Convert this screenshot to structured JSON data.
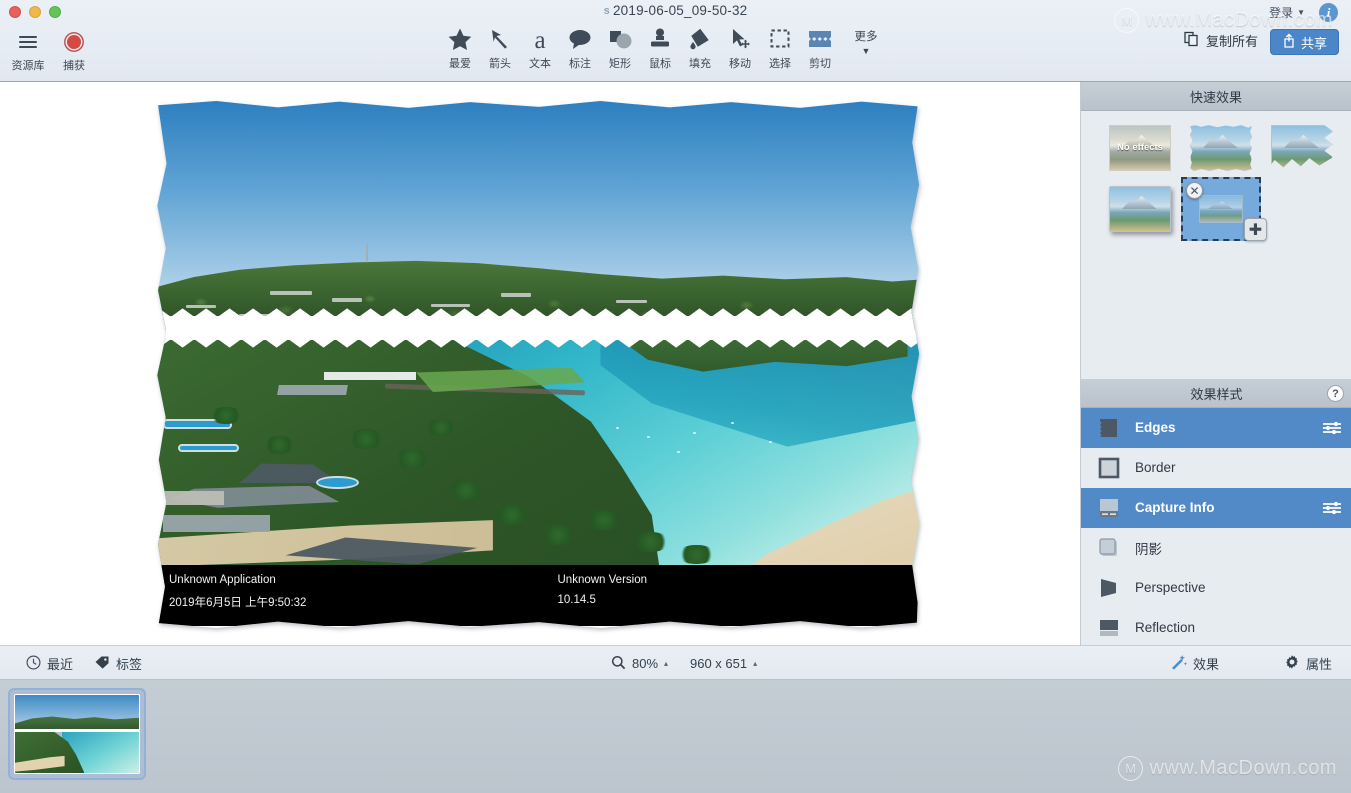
{
  "window": {
    "title": "2019-06-05_09-50-32",
    "title_icon": "s",
    "traffic_lights": [
      "close",
      "minimize",
      "zoom"
    ]
  },
  "left_tools": [
    {
      "label": "资源库",
      "icon": "library-icon"
    },
    {
      "label": "捕获",
      "icon": "capture-record-icon"
    }
  ],
  "center_tools": [
    {
      "label": "最爱",
      "icon": "star-icon"
    },
    {
      "label": "箭头",
      "icon": "arrow-icon"
    },
    {
      "label": "文本",
      "icon": "text-icon"
    },
    {
      "label": "标注",
      "icon": "callout-icon"
    },
    {
      "label": "矩形",
      "icon": "shapes-icon"
    },
    {
      "label": "鼠标",
      "icon": "stamp-icon"
    },
    {
      "label": "填充",
      "icon": "fill-icon"
    },
    {
      "label": "移动",
      "icon": "move-icon"
    },
    {
      "label": "选择",
      "icon": "selection-icon"
    },
    {
      "label": "剪切",
      "icon": "cut-icon"
    }
  ],
  "more_tool": {
    "label": "更多",
    "caret": "▼"
  },
  "account": {
    "signin_label": "登录",
    "caret": "▼",
    "info_label": "i"
  },
  "actions": {
    "copy_all_label": "复制所有",
    "share_label": "共享"
  },
  "quick_effects": {
    "title": "快速效果",
    "items": [
      {
        "name": "no-effects",
        "label": "No effects"
      },
      {
        "name": "torn-edges",
        "label": ""
      },
      {
        "name": "zigzag-edges",
        "label": ""
      },
      {
        "name": "drop-shadow",
        "label": ""
      },
      {
        "name": "add-new-effect",
        "label": "",
        "selected": true,
        "remove_badge": "✕",
        "add_badge": "✚"
      }
    ]
  },
  "effect_styles": {
    "title": "效果样式",
    "help_label": "?",
    "rows": [
      {
        "label": "Edges",
        "icon": "torn-edge-icon",
        "active": true,
        "has_slider": true
      },
      {
        "label": "Border",
        "icon": "border-icon",
        "active": false,
        "has_slider": false
      },
      {
        "label": "Capture Info",
        "icon": "capture-info-icon",
        "active": true,
        "has_slider": true
      },
      {
        "label": "阴影",
        "icon": "shadow-icon",
        "active": false,
        "has_slider": false
      },
      {
        "label": "Perspective",
        "icon": "perspective-icon",
        "active": false,
        "has_slider": false
      },
      {
        "label": "Reflection",
        "icon": "reflection-icon",
        "active": false,
        "has_slider": false
      }
    ]
  },
  "capture_info_overlay": {
    "app_name": "Unknown Application",
    "version_label": "Unknown Version",
    "timestamp": "2019年6月5日 上午9:50:32",
    "os_version": "10.14.5"
  },
  "statusbar": {
    "recent_label": "最近",
    "tags_label": "标签",
    "zoom_value": "80%",
    "zoom_caret": "▴",
    "dimensions": "960 x 651",
    "dimensions_caret": "▴",
    "effects_label": "效果",
    "properties_label": "属性"
  },
  "watermark": {
    "text": "www.MacDown.com",
    "mark": "M"
  },
  "colors": {
    "accent_blue": "#5289c7",
    "share_button": "#4a86c8",
    "panel_header": "#bfc8d1",
    "titlebar": "#e6ecf3",
    "capture_info_bg": "#000000"
  }
}
